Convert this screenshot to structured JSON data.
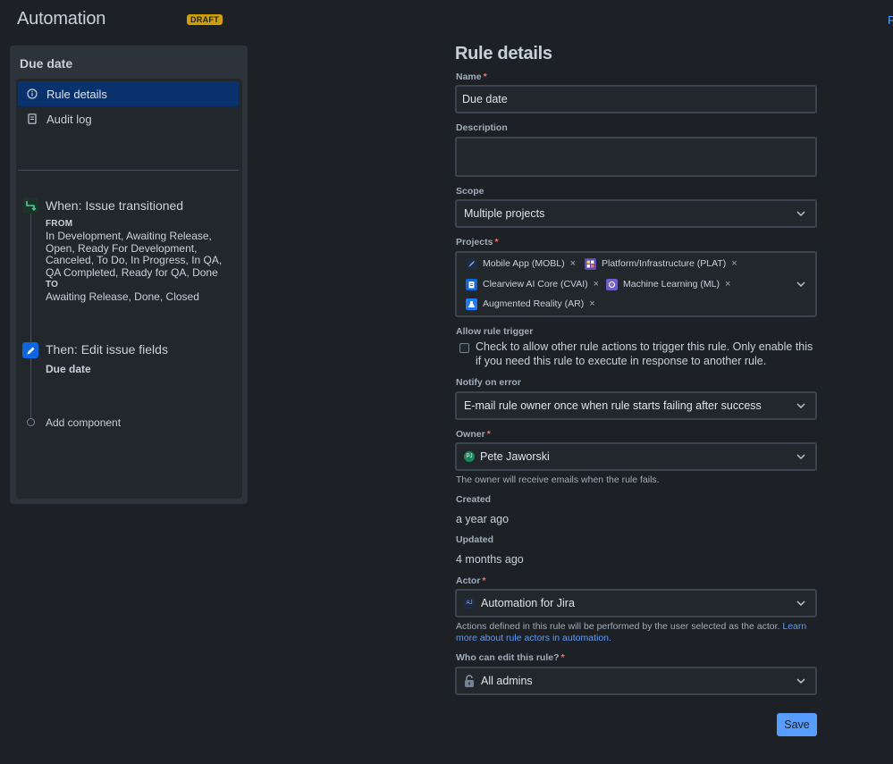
{
  "header": {
    "title": "Automation",
    "badge": "DRAFT",
    "right_link": "F"
  },
  "rule_panel": {
    "title": "Due date",
    "nav": [
      {
        "label": "Rule details",
        "icon": "info-icon",
        "active": true
      },
      {
        "label": "Audit log",
        "icon": "document-icon",
        "active": false
      }
    ],
    "trigger": {
      "title": "When: Issue transitioned",
      "from_label": "FROM",
      "from_text": "In Development, Awaiting Release, Open, Ready For Development, Canceled, To Do, In Progress, In QA, QA Completed, Ready for QA, Done",
      "to_label": "TO",
      "to_text": "Awaiting Release, Done, Closed",
      "icon": "transition-icon"
    },
    "action": {
      "title": "Then: Edit issue fields",
      "field": "Due date",
      "icon": "pencil-icon"
    },
    "add_component": "Add component"
  },
  "form": {
    "title": "Rule details",
    "name": {
      "label": "Name",
      "required": "*",
      "value": "Due date"
    },
    "description": {
      "label": "Description",
      "value": ""
    },
    "scope": {
      "label": "Scope",
      "value": "Multiple projects"
    },
    "projects": {
      "label": "Projects",
      "required": "*",
      "items": [
        {
          "name": "Mobile App (MOBL)",
          "icon_color": "#1c2b41"
        },
        {
          "name": "Platform/Infrastructure (PLAT)",
          "icon_color": "#5e4db2"
        },
        {
          "name": "Clearview AI Core (CVAI)",
          "icon_color": "#0c66e4"
        },
        {
          "name": "Machine Learning (ML)",
          "icon_color": "#6e5dc6"
        },
        {
          "name": "Augmented Reality (AR)",
          "icon_color": "#1d7afc"
        }
      ],
      "remove_glyph": "×"
    },
    "allow_trigger": {
      "label": "Allow rule trigger",
      "text": "Check to allow other rule actions to trigger this rule. Only enable this if you need this rule to execute in response to another rule."
    },
    "notify": {
      "label": "Notify on error",
      "value": "E-mail rule owner once when rule starts failing after success"
    },
    "owner": {
      "label": "Owner",
      "required": "*",
      "value": "Pete Jaworski",
      "avatar_initials": "PJ",
      "helper": "The owner will receive emails when the rule fails."
    },
    "created": {
      "label": "Created",
      "value": "a year ago"
    },
    "updated": {
      "label": "Updated",
      "value": "4 months ago"
    },
    "actor": {
      "label": "Actor",
      "required": "*",
      "value": "Automation for Jira",
      "icon_text": "AJ",
      "helper": "Actions defined in this rule will be performed by the user selected as the actor.",
      "helper_link": "Learn more about rule actors in automation."
    },
    "editors": {
      "label": "Who can edit this rule?",
      "required": "*",
      "value": "All admins"
    },
    "save_label": "Save"
  }
}
